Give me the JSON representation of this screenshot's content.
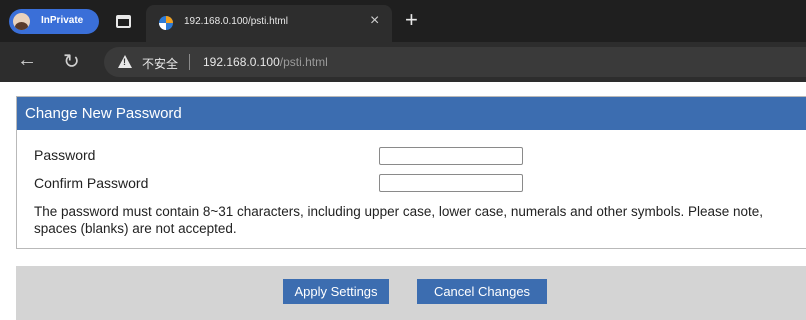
{
  "browser": {
    "inprivate_label": "InPrivate",
    "tab_title": "192.168.0.100/psti.html",
    "tab_close": "×",
    "new_tab": "+",
    "insecure_label": "不安全",
    "url_host": "192.168.0.100",
    "url_path": "/psti.html"
  },
  "form": {
    "header": "Change New Password",
    "password_label": "Password",
    "confirm_label": "Confirm Password",
    "password_value": "",
    "confirm_value": "",
    "note": "The password must contain 8~31 characters, including upper case, lower case, numerals and other symbols. Please note, spaces (blanks) are not accepted."
  },
  "actions": {
    "apply_label": "Apply Settings",
    "cancel_label": "Cancel Changes"
  },
  "colors": {
    "header_blue": "#3c6db0",
    "inprivate_blue": "#3a6fd8",
    "chrome_dark": "#1f1f1f",
    "action_bar_gray": "#d4d4d4"
  }
}
